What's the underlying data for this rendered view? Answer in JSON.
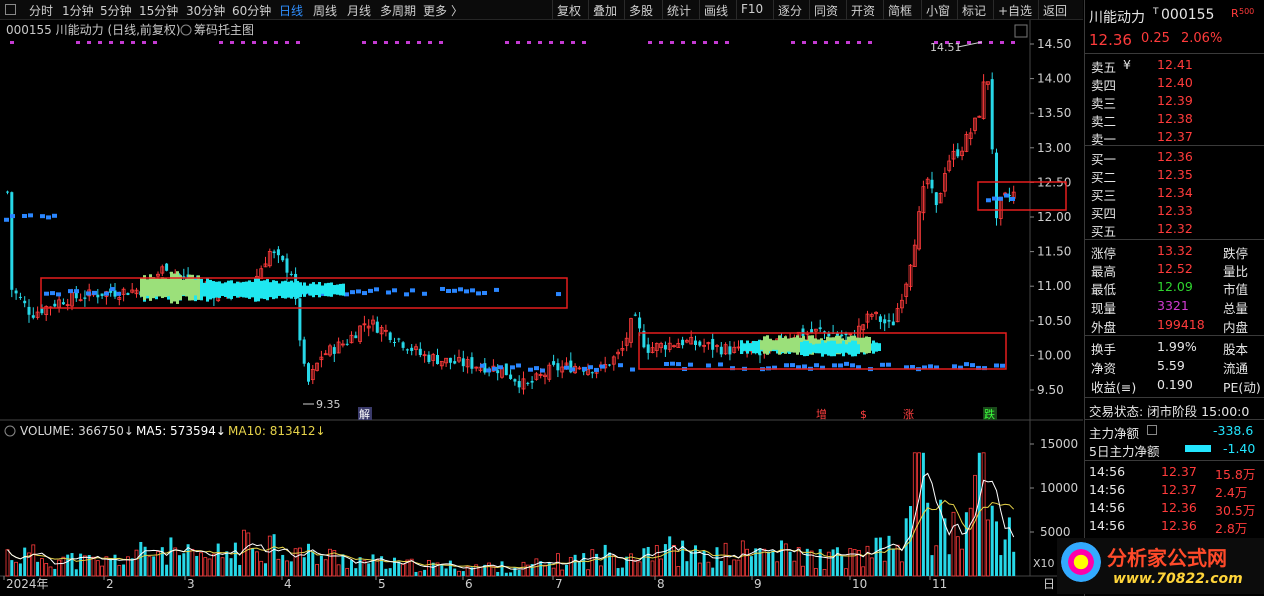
{
  "toolbar": {
    "periods": [
      "分时",
      "1分钟",
      "5分钟",
      "15分钟",
      "30分钟",
      "60分钟",
      "日线",
      "周线",
      "月线",
      "多周期",
      "更多"
    ],
    "active": "日线",
    "more_arrow": "〉",
    "tools": [
      "复权",
      "叠加",
      "多股",
      "统计",
      "画线",
      "F10",
      "逐分",
      "同资",
      "开资",
      "简框",
      "小窗",
      "标记",
      "+自选",
      "返回"
    ]
  },
  "chart": {
    "title": "000155 川能动力 (日线,前复权)",
    "chip_label": "筹码托主图",
    "price_axis": [
      "14.50",
      "14.00",
      "13.50",
      "13.00",
      "12.50",
      "12.00",
      "11.50",
      "11.00",
      "10.50",
      "10.00",
      "9.50"
    ],
    "high_annotation": "14.51",
    "low_annotation": "9.35",
    "markers": {
      "jie": "解",
      "zeng": "增",
      "dollar": "$",
      "zhang": "涨",
      "die": "跌"
    },
    "time_axis": [
      "2024年",
      "2",
      "3",
      "4",
      "5",
      "6",
      "7",
      "8",
      "9",
      "10",
      "11"
    ],
    "volume": {
      "label": "VOLUME: 366750",
      "ma5": "MA5: 573594",
      "ma10": "MA10: 813412",
      "arrow": "↓",
      "axis": [
        "15000",
        "10000",
        "5000"
      ],
      "unit": "X10",
      "unit2": "日"
    },
    "colors": {
      "up": "#ff3b3b",
      "down": "#27d8e8",
      "chip": "#2a86ff",
      "chip_profit": "#1fe7f0",
      "chip_green": "#9be07a",
      "ma5": "#ffffff",
      "ma10": "#e6d34a",
      "box": "#e61e1e"
    }
  },
  "quote": {
    "name": "川能动力",
    "t_flag": "T",
    "code": "000155",
    "r_flag": "R",
    "r500": "500",
    "price": "12.36",
    "change": "0.25",
    "change_pct": "2.06%",
    "asks": [
      {
        "label": "卖五",
        "sym": "¥",
        "price": "12.41"
      },
      {
        "label": "卖四",
        "price": "12.40"
      },
      {
        "label": "卖三",
        "price": "12.39"
      },
      {
        "label": "卖二",
        "price": "12.38"
      },
      {
        "label": "卖一",
        "price": "12.37"
      }
    ],
    "bids": [
      {
        "label": "买一",
        "price": "12.36"
      },
      {
        "label": "买二",
        "price": "12.35"
      },
      {
        "label": "买三",
        "price": "12.34"
      },
      {
        "label": "买四",
        "price": "12.33"
      },
      {
        "label": "买五",
        "price": "12.32"
      }
    ],
    "stats": [
      {
        "l": "涨停",
        "v": "13.32",
        "r": "跌停"
      },
      {
        "l": "最高",
        "v": "12.52",
        "r": "量比"
      },
      {
        "l": "最低",
        "v": "12.09",
        "r": "市值"
      },
      {
        "l": "现量",
        "v": "3321",
        "r": "总量"
      },
      {
        "l": "外盘",
        "v": "199418",
        "r": "内盘"
      }
    ],
    "stats2": [
      {
        "l": "换手",
        "v": "1.99%",
        "r": "股本"
      },
      {
        "l": "净资",
        "v": "5.59",
        "r": "流通"
      },
      {
        "l": "收益(≡)",
        "v": "0.190",
        "r": "PE(动)"
      }
    ],
    "trade_status": "交易状态: 闭市阶段 15:00:0",
    "main_net": {
      "label": "主力净额",
      "value": "-338.6"
    },
    "main_net5": {
      "label": "5日主力净额",
      "value": "-1.40"
    },
    "ticks": [
      {
        "t": "14:56",
        "p": "12.37",
        "v": "15.8万"
      },
      {
        "t": "14:56",
        "p": "12.37",
        "v": "2.4万"
      },
      {
        "t": "14:56",
        "p": "12.36",
        "v": "30.5万"
      },
      {
        "t": "14:56",
        "p": "12.36",
        "v": "2.8万"
      }
    ]
  },
  "watermark": {
    "brand": "分析家公式网",
    "url": "www.70822.com"
  }
}
